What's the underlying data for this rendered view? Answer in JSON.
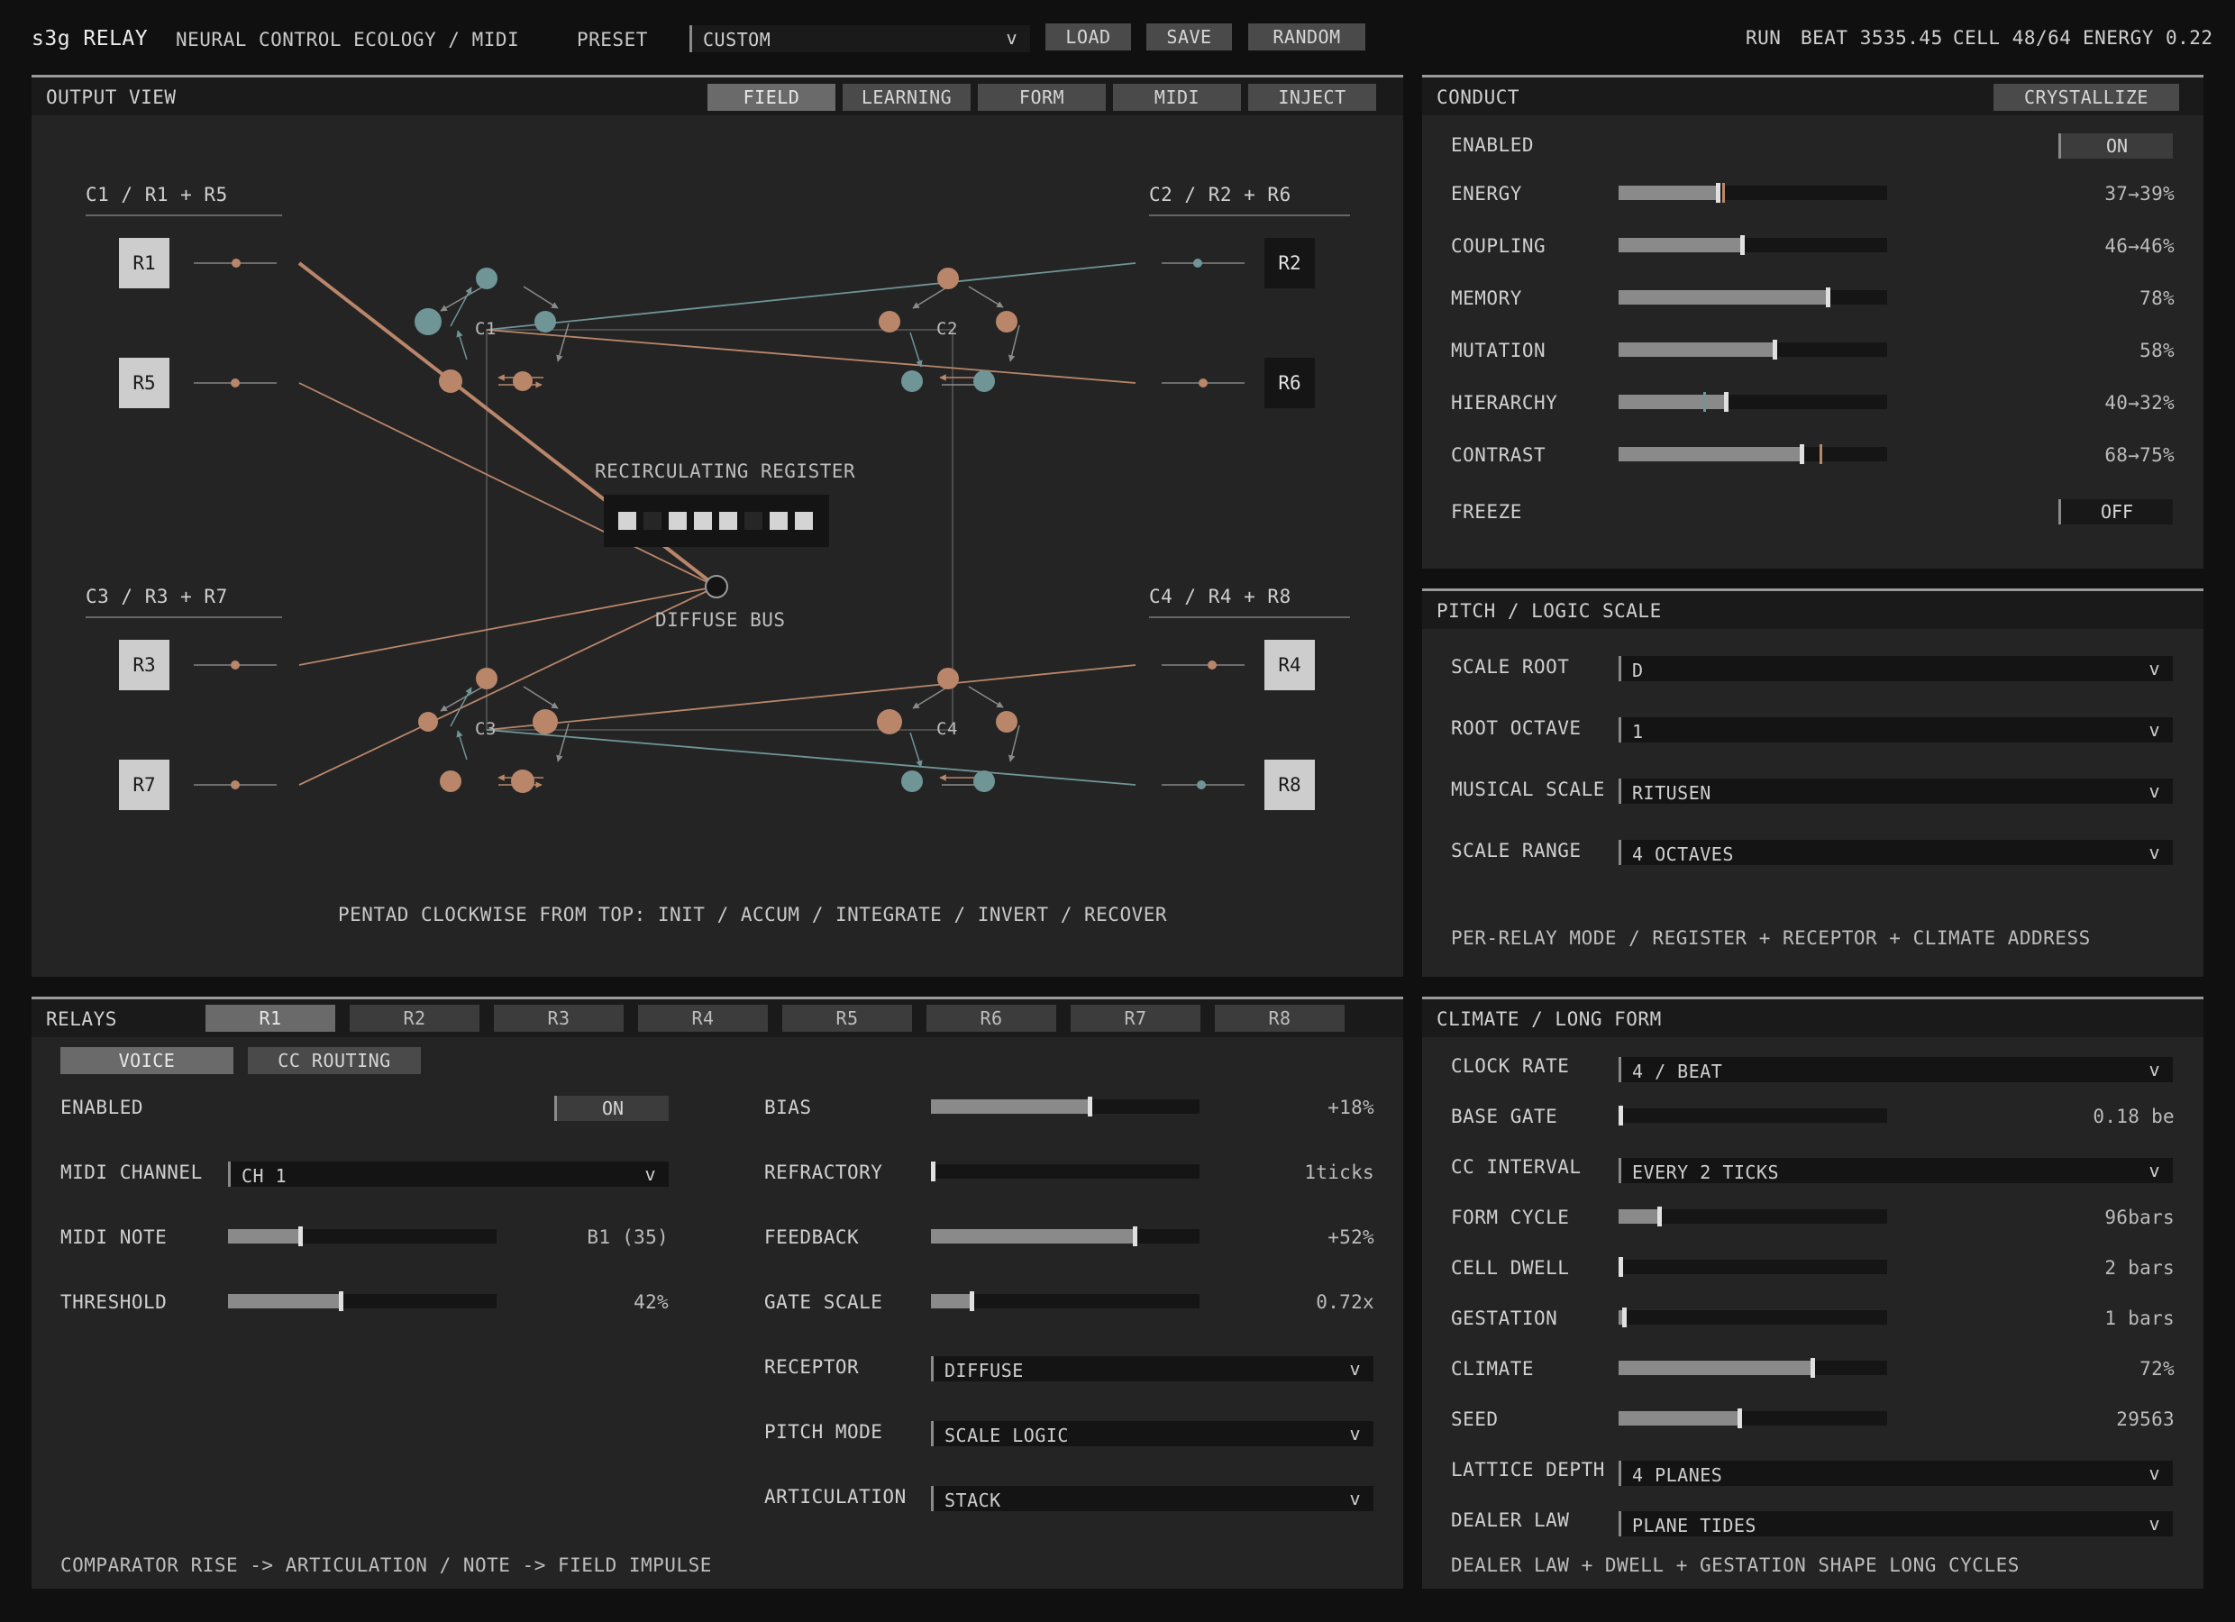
{
  "header": {
    "app": "s3g RELAY",
    "subtitle": "NEURAL CONTROL ECOLOGY / MIDI",
    "preset_label": "PRESET",
    "preset_value": "CUSTOM",
    "load": "LOAD",
    "save": "SAVE",
    "random": "RANDOM",
    "run": "RUN",
    "beat": "BEAT 3535.45",
    "cell": "CELL 48/64",
    "energy": "ENERGY 0.22"
  },
  "output": {
    "title": "OUTPUT VIEW",
    "tabs": [
      "FIELD",
      "LEARNING",
      "FORM",
      "MIDI",
      "INJECT"
    ],
    "active_tab": "FIELD",
    "group_c1": "C1 / R1 + R5",
    "group_c2": "C2 / R2 + R6",
    "group_c3": "C3 / R3 + R7",
    "group_c4": "C4 / R4 + R8",
    "relays": {
      "r1": "R1",
      "r2": "R2",
      "r3": "R3",
      "r4": "R4",
      "r5": "R5",
      "r6": "R6",
      "r7": "R7",
      "r8": "R8"
    },
    "cells": {
      "c1": "C1",
      "c2": "C2",
      "c3": "C3",
      "c4": "C4"
    },
    "register_label": "RECIRCULATING REGISTER",
    "register_bits": [
      1,
      0,
      1,
      1,
      1,
      0,
      1,
      1
    ],
    "bus_label": "DIFFUSE BUS",
    "footnote": "PENTAD CLOCKWISE FROM TOP: INIT / ACCUM / INTEGRATE / INVERT / RECOVER",
    "colors": {
      "teal": "#6f9597",
      "copper": "#b9866a",
      "line": "#6b6b6b"
    }
  },
  "conduct": {
    "title": "CONDUCT",
    "crystallize": "CRYSTALLIZE",
    "enabled_label": "ENABLED",
    "enabled_value": "ON",
    "freeze_label": "FREEZE",
    "freeze_value": "OFF",
    "sliders": [
      {
        "label": "ENERGY",
        "value": "37→39%",
        "level": 0.37,
        "target": 0.39
      },
      {
        "label": "COUPLING",
        "value": "46→46%",
        "level": 0.46,
        "target": 0.46
      },
      {
        "label": "MEMORY",
        "value": "78%",
        "level": 0.78
      },
      {
        "label": "MUTATION",
        "value": "58%",
        "level": 0.58
      },
      {
        "label": "HIERARCHY",
        "value": "40→32%",
        "level": 0.4,
        "target": 0.32
      },
      {
        "label": "CONTRAST",
        "value": "68→75%",
        "level": 0.68,
        "target": 0.75
      }
    ]
  },
  "pitch": {
    "title": "PITCH / LOGIC SCALE",
    "rows": [
      {
        "label": "SCALE ROOT",
        "value": "D"
      },
      {
        "label": "ROOT OCTAVE",
        "value": "1"
      },
      {
        "label": "MUSICAL SCALE",
        "value": "RITUSEN"
      },
      {
        "label": "SCALE RANGE",
        "value": "4 OCTAVES"
      }
    ],
    "footnote": "PER-RELAY MODE / REGISTER + RECEPTOR + CLIMATE ADDRESS"
  },
  "relays": {
    "title": "RELAYS",
    "tabs": [
      "R1",
      "R2",
      "R3",
      "R4",
      "R5",
      "R6",
      "R7",
      "R8"
    ],
    "active_tab": "R1",
    "subtabs": [
      "VOICE",
      "CC ROUTING"
    ],
    "active_subtab": "VOICE",
    "enabled_label": "ENABLED",
    "enabled_value": "ON",
    "midi_channel_label": "MIDI CHANNEL",
    "midi_channel_value": "CH 1",
    "midi_note_label": "MIDI NOTE",
    "midi_note_value": "B1 (35)",
    "midi_note_level": 0.27,
    "threshold_label": "THRESHOLD",
    "threshold_value": "42%",
    "threshold_level": 0.42,
    "right_sliders": [
      {
        "label": "BIAS",
        "value": "+18%",
        "level": 0.59
      },
      {
        "label": "REFRACTORY",
        "value": "1ticks",
        "level": 0.0
      },
      {
        "label": "FEEDBACK",
        "value": "+52%",
        "level": 0.76
      },
      {
        "label": "GATE SCALE",
        "value": "0.72x",
        "level": 0.15
      }
    ],
    "receptor_label": "RECEPTOR",
    "receptor_value": "DIFFUSE",
    "pitch_mode_label": "PITCH MODE",
    "pitch_mode_value": "SCALE LOGIC",
    "articulation_label": "ARTICULATION",
    "articulation_value": "STACK",
    "footnote": "COMPARATOR RISE -> ARTICULATION / NOTE -> FIELD IMPULSE"
  },
  "climate": {
    "title": "CLIMATE / LONG FORM",
    "clock_rate_label": "CLOCK RATE",
    "clock_rate_value": "4 / BEAT",
    "base_gate_label": "BASE GATE",
    "base_gate_value": "0.18 be",
    "base_gate_level": 0.0,
    "cc_interval_label": "CC INTERVAL",
    "cc_interval_value": "EVERY 2 TICKS",
    "form_cycle_label": "FORM CYCLE",
    "form_cycle_value": "96bars",
    "form_cycle_level": 0.15,
    "cell_dwell_label": "CELL DWELL",
    "cell_dwell_value": "2 bars",
    "cell_dwell_level": 0.0,
    "gestation_label": "GESTATION",
    "gestation_value": "1 bars",
    "gestation_level": 0.02,
    "climate_label": "CLIMATE",
    "climate_value": "72%",
    "climate_level": 0.72,
    "seed_label": "SEED",
    "seed_value": "29563",
    "seed_level": 0.45,
    "lattice_label": "LATTICE DEPTH",
    "lattice_value": "4 PLANES",
    "dealer_label": "DEALER LAW",
    "dealer_value": "PLANE TIDES",
    "footnote": "DEALER LAW + DWELL + GESTATION SHAPE LONG CYCLES"
  }
}
